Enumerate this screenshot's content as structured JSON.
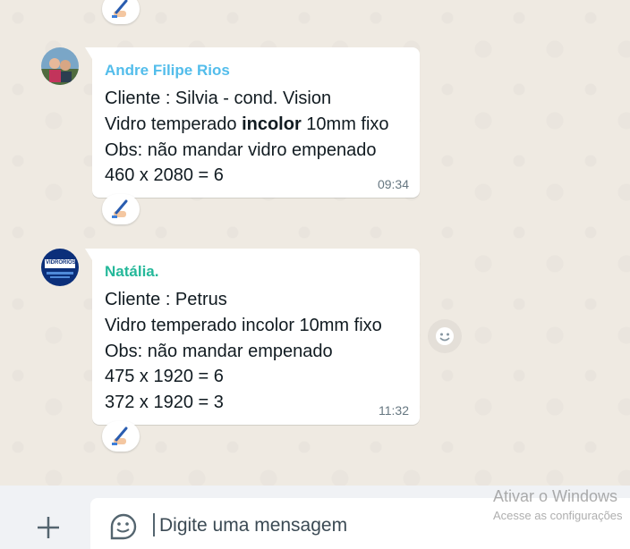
{
  "messages": [
    {
      "sender": "Andre Filipe Rios",
      "sender_color": "#53bdeb",
      "lines": [
        "Cliente : Silvia - cond. Vision",
        "Vidro temperado ",
        "incolor",
        " 10mm fixo",
        "Obs: não mandar vidro empenado",
        "460 x 2080 = 6"
      ],
      "time": "09:34",
      "reaction": "writing-hand"
    },
    {
      "sender": "Natália.",
      "sender_color": "#25b89a",
      "avatar_text": "VIDRORIOS",
      "lines": [
        "Cliente : Petrus",
        "Vidro temperado incolor 10mm fixo",
        "Obs: não mandar empenado",
        "475 x 1920 = 6",
        "372 x 1920 = 3"
      ],
      "time": "11:32",
      "reaction": "writing-hand"
    }
  ],
  "composer": {
    "placeholder": "Digite uma mensagem",
    "attach_icon": "plus-icon",
    "sticker_icon": "sticker-icon"
  },
  "watermark": {
    "title": "Ativar o Windows",
    "subtitle": "Acesse as configurações"
  },
  "colors": {
    "chat_bg": "#efeae2",
    "bubble": "#ffffff",
    "footer": "#f0f2f5"
  }
}
